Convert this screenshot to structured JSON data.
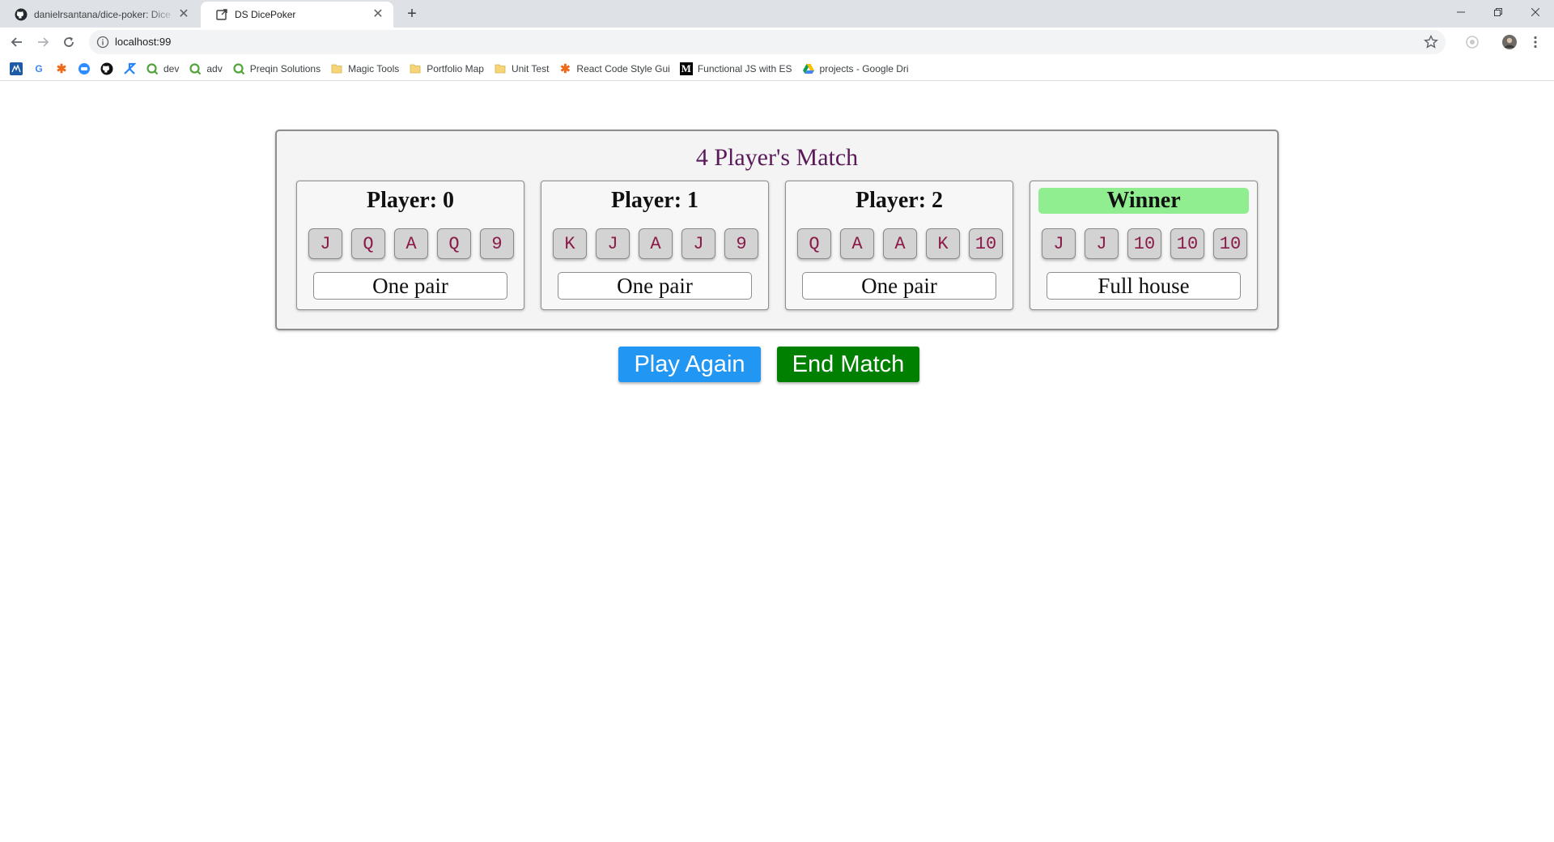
{
  "browser": {
    "tabs": [
      {
        "title": "danielrsantana/dice-poker: Dice",
        "icon": "github-icon",
        "active": false
      },
      {
        "title": "DS DicePoker",
        "icon": "external-link-icon",
        "active": true
      }
    ],
    "new_tab": "+",
    "address": {
      "url": "localhost:99"
    },
    "bookmarks": [
      {
        "label": "",
        "icon": "bookmark-app-icon"
      },
      {
        "label": "",
        "icon": "google-icon"
      },
      {
        "label": "",
        "icon": "asterisk-app-icon"
      },
      {
        "label": "",
        "icon": "chat-app-icon"
      },
      {
        "label": "",
        "icon": "github-icon"
      },
      {
        "label": "",
        "icon": "jira-icon"
      },
      {
        "label": "dev",
        "icon": "qlik-icon"
      },
      {
        "label": "adv",
        "icon": "qlik-icon"
      },
      {
        "label": "Preqin Solutions",
        "icon": "qlik-icon"
      },
      {
        "label": "Magic Tools",
        "icon": "folder-icon"
      },
      {
        "label": "Portfolio Map",
        "icon": "folder-icon"
      },
      {
        "label": "Unit Test",
        "icon": "folder-icon"
      },
      {
        "label": "React Code Style Gui",
        "icon": "asterisk-icon"
      },
      {
        "label": "Functional JS with ES",
        "icon": "medium-icon"
      },
      {
        "label": "projects - Google Dri",
        "icon": "google-drive-icon"
      }
    ]
  },
  "match": {
    "title": "4 Player's Match",
    "players": [
      {
        "name": "Player: 0",
        "winner": false,
        "dice": [
          "J",
          "Q",
          "A",
          "Q",
          "9"
        ],
        "hand": "One pair"
      },
      {
        "name": "Player: 1",
        "winner": false,
        "dice": [
          "K",
          "J",
          "A",
          "J",
          "9"
        ],
        "hand": "One pair"
      },
      {
        "name": "Player: 2",
        "winner": false,
        "dice": [
          "Q",
          "A",
          "A",
          "K",
          "10"
        ],
        "hand": "One pair"
      },
      {
        "name": "Winner",
        "winner": true,
        "dice": [
          "J",
          "J",
          "10",
          "10",
          "10"
        ],
        "hand": "Full house"
      }
    ]
  },
  "actions": {
    "play_again": "Play Again",
    "end_match": "End Match"
  },
  "colors": {
    "title": "#5a1a5a",
    "die_face": "#8b1a4a",
    "winner_highlight": "#90ee90",
    "play_again": "#2196f3",
    "end_match": "#008000"
  }
}
